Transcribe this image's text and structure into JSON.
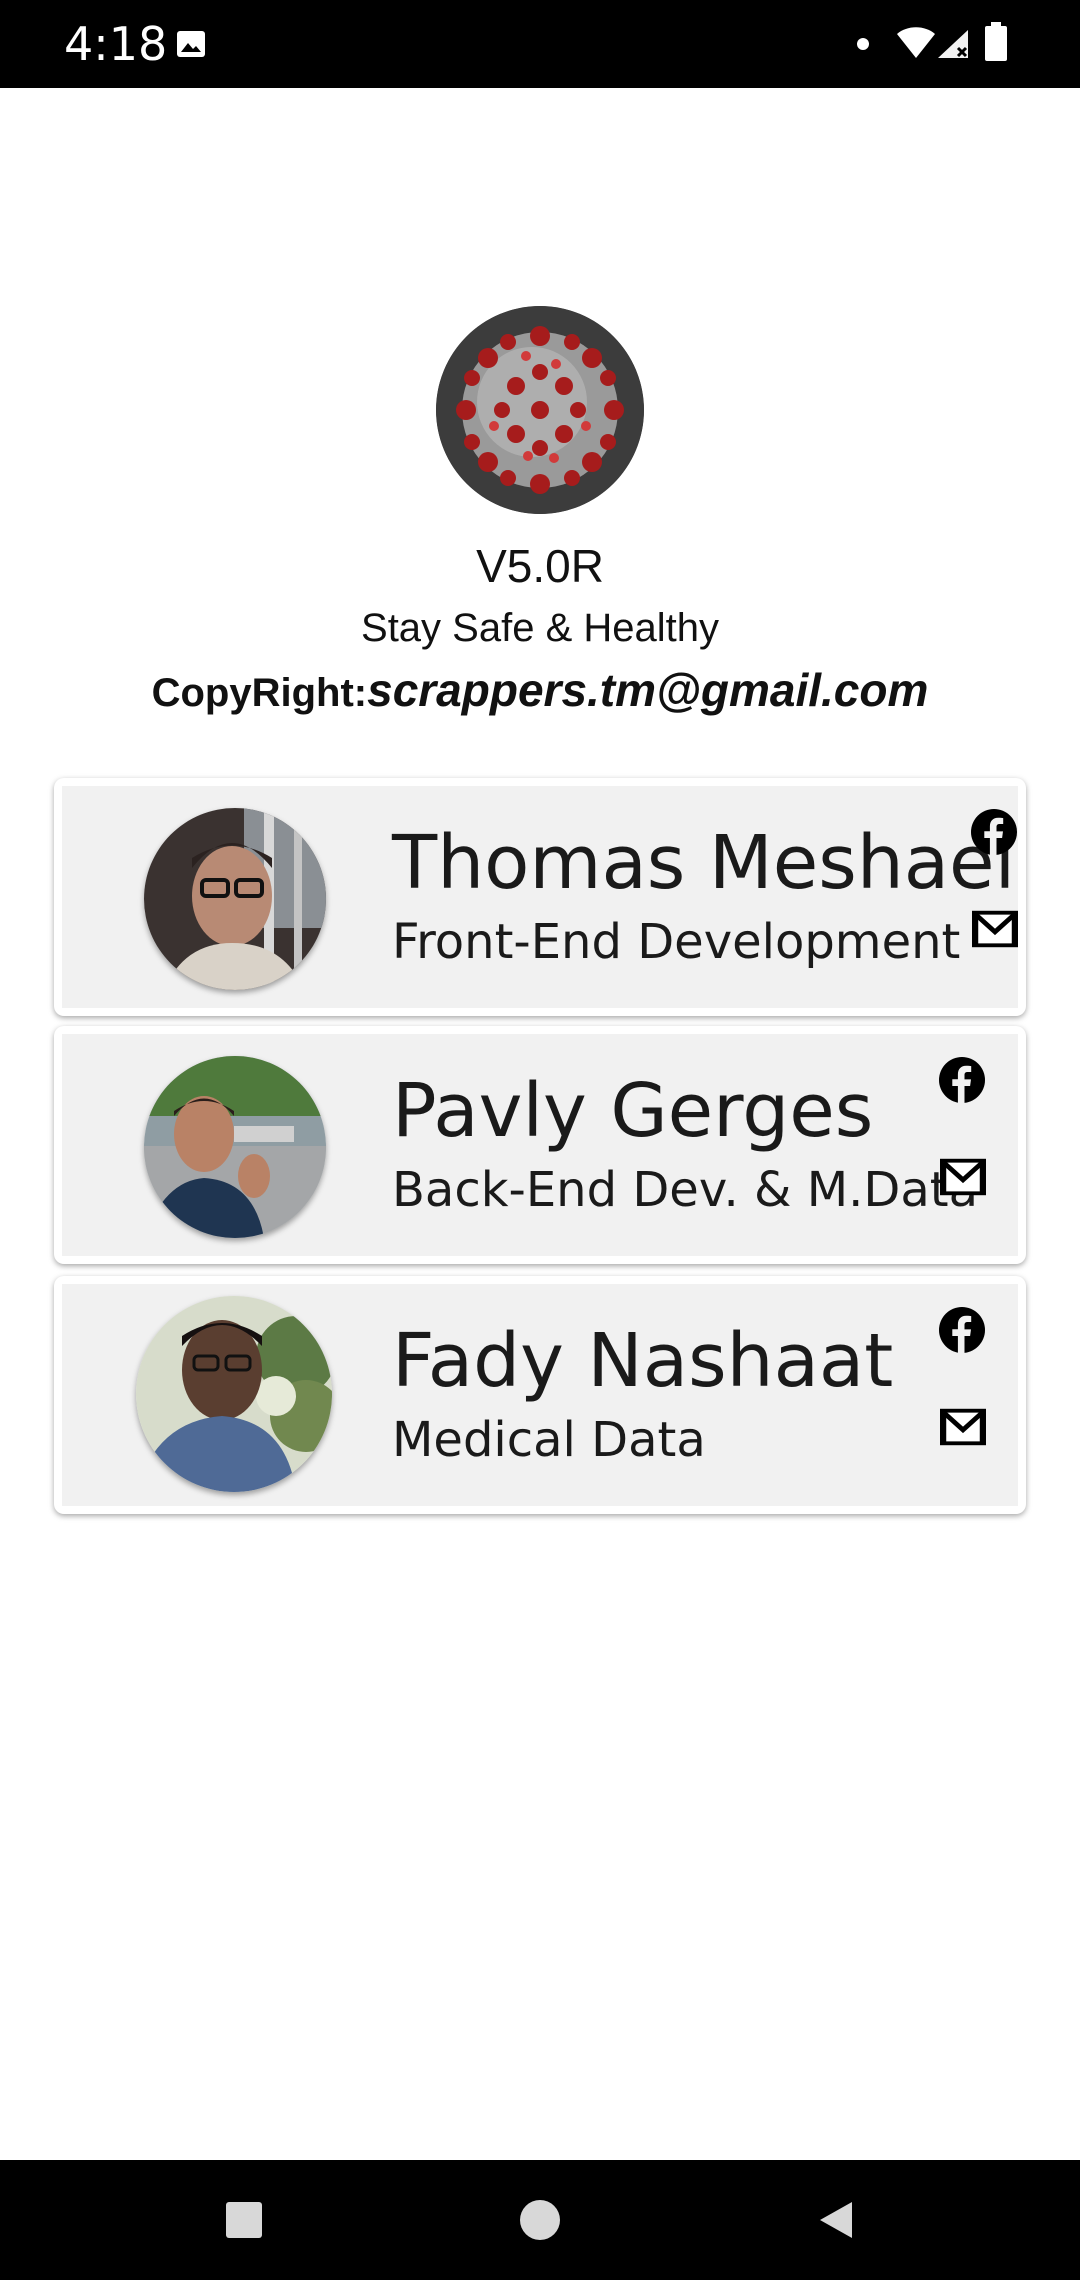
{
  "status_bar": {
    "time": "4:18",
    "icons": [
      "image-icon",
      "dot-icon",
      "wifi-icon",
      "signal-icon",
      "battery-icon"
    ]
  },
  "header": {
    "logo_icon": "coronavirus-logo",
    "version": "V5.0R",
    "tagline": "Stay Safe & Healthy",
    "copyright_label": "CopyRight:",
    "copyright_email": "scrappers.tm@gmail.com"
  },
  "team": [
    {
      "name": "Thomas Meshael",
      "role": "Front-End Development",
      "icons": [
        "facebook-icon",
        "gmail-icon"
      ]
    },
    {
      "name": "Pavly Gerges",
      "role": "Back-End Dev. & M.Data",
      "icons": [
        "facebook-icon",
        "gmail-icon"
      ]
    },
    {
      "name": "Fady Nashaat",
      "role": "Medical Data",
      "icons": [
        "facebook-icon",
        "gmail-icon"
      ]
    }
  ],
  "nav_bar": {
    "icons": [
      "recents-icon",
      "home-icon",
      "back-icon"
    ]
  },
  "colors": {
    "status_bar": "#000000",
    "card_background": "#f1f1f1",
    "text": "#1a1a1a",
    "virus_red": "#a61c1c"
  }
}
